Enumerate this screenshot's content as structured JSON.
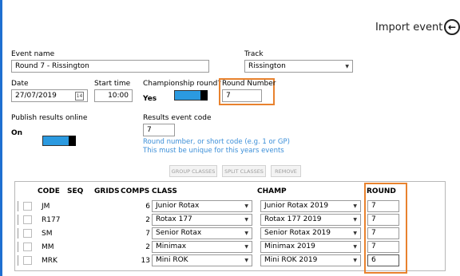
{
  "header": {
    "title": "Import event",
    "back_icon": "arrow-left-icon"
  },
  "form": {
    "event_name_label": "Event name",
    "event_name_value": "Round 7 - Rissington",
    "track_label": "Track",
    "track_value": "Rissington",
    "date_label": "Date",
    "date_value": "27/07/2019",
    "date_icon": "calendar-icon",
    "date_icon_text": "14",
    "start_time_label": "Start time",
    "start_time_value": "10:00",
    "championship_label": "Championship round?",
    "championship_state": "Yes",
    "round_number_label": "Round Number",
    "round_number_value": "7",
    "publish_label": "Publish results online",
    "publish_state": "On",
    "results_code_label": "Results event code",
    "results_code_value": "7",
    "hint_line1": "Round number, or short code (e.g. 1 or GP)",
    "hint_line2": "This must be unique for this years events",
    "toggle_color": "#2b9ae0",
    "highlight_color": "#e8822e",
    "accent_color": "#1f6fd1"
  },
  "actions": {
    "group_classes": "GROUP CLASSES",
    "split_classes": "SPLIT CLASSES",
    "remove": "REMOVE"
  },
  "table": {
    "columns": {
      "code": "CODE",
      "seq": "SEQ",
      "grids": "GRIDS",
      "comps": "COMPS",
      "class": "CLASS",
      "champ": "CHAMP",
      "round": "ROUND"
    },
    "rows": [
      {
        "code": "JM",
        "seq": "",
        "grids": "",
        "comps": "6",
        "class": "Junior Rotax",
        "champ": "Junior Rotax 2019",
        "round": "7"
      },
      {
        "code": "R177",
        "seq": "",
        "grids": "",
        "comps": "2",
        "class": "Rotax 177",
        "champ": "Rotax 177 2019",
        "round": "7"
      },
      {
        "code": "SM",
        "seq": "",
        "grids": "",
        "comps": "7",
        "class": "Senior Rotax",
        "champ": "Senior Rotax 2019",
        "round": "7"
      },
      {
        "code": "MM",
        "seq": "",
        "grids": "",
        "comps": "2",
        "class": "Minimax",
        "champ": "Minimax 2019",
        "round": "7"
      },
      {
        "code": "MRK",
        "seq": "",
        "grids": "",
        "comps": "13",
        "class": "Mini ROK",
        "champ": "Mini ROK 2019",
        "round": "6"
      }
    ]
  }
}
